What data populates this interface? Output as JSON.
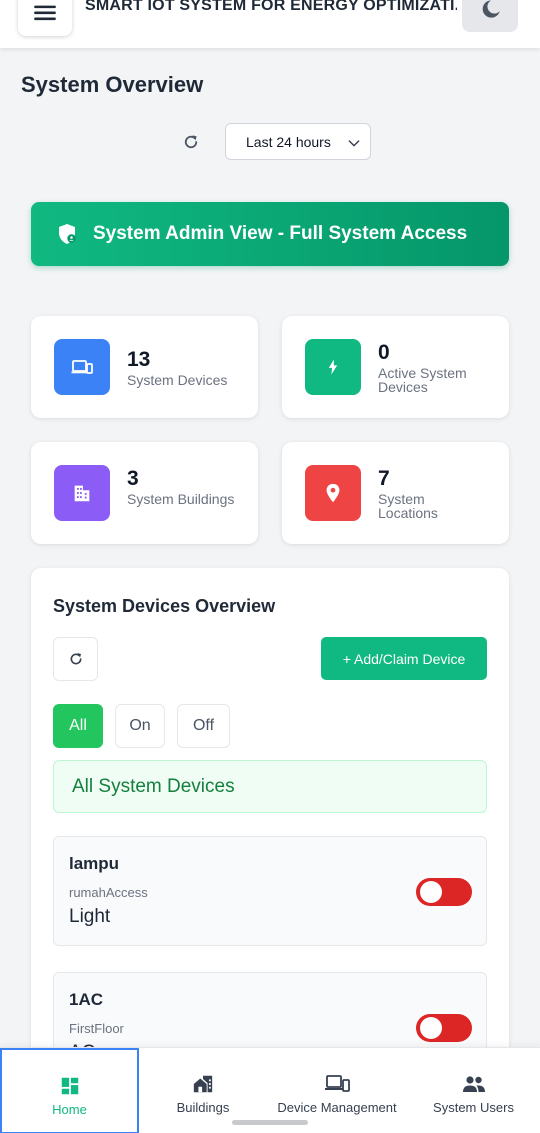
{
  "header": {
    "title": "SMART IOT SYSTEM FOR ENERGY OPTIMIZATI...",
    "menu_icon": "hamburger-menu-icon",
    "theme_icon": "moon-icon"
  },
  "page": {
    "title": "System Overview",
    "time_range": {
      "selected": "Last 24 hours"
    }
  },
  "admin_banner": {
    "text": "System Admin View - Full System Access",
    "icon": "shield-icon"
  },
  "stats": [
    {
      "value": "13",
      "label": "System Devices",
      "icon": "devices-icon",
      "color": "#3b82f6"
    },
    {
      "value": "0",
      "label": "Active System Devices",
      "icon": "bolt-icon",
      "color": "#10b981"
    },
    {
      "value": "3",
      "label": "System Buildings",
      "icon": "building-icon",
      "color": "#8b5cf6"
    },
    {
      "value": "7",
      "label": "System Locations",
      "icon": "location-pin-icon",
      "color": "#ef4444"
    }
  ],
  "devices_panel": {
    "title": "System Devices Overview",
    "add_button": "+ Add/Claim Device",
    "filters": [
      "All",
      "On",
      "Off"
    ],
    "active_filter": "All",
    "heading": "All System Devices",
    "devices": [
      {
        "name": "lampu",
        "location": "rumahAccess",
        "type": "Light",
        "state": "off"
      },
      {
        "name": "1AC",
        "location": "FirstFloor",
        "type": "AC",
        "state": "off"
      }
    ]
  },
  "bottom_nav": {
    "items": [
      {
        "label": "Home",
        "icon": "dashboard-icon",
        "active": true
      },
      {
        "label": "Buildings",
        "icon": "buildings-icon",
        "active": false
      },
      {
        "label": "Device Management",
        "icon": "devices-icon",
        "active": false
      },
      {
        "label": "System Users",
        "icon": "users-icon",
        "active": false
      }
    ]
  },
  "colors": {
    "accent_green": "#10b981",
    "toggle_off": "#dc2626",
    "active_nav_border": "#3b82f6"
  }
}
